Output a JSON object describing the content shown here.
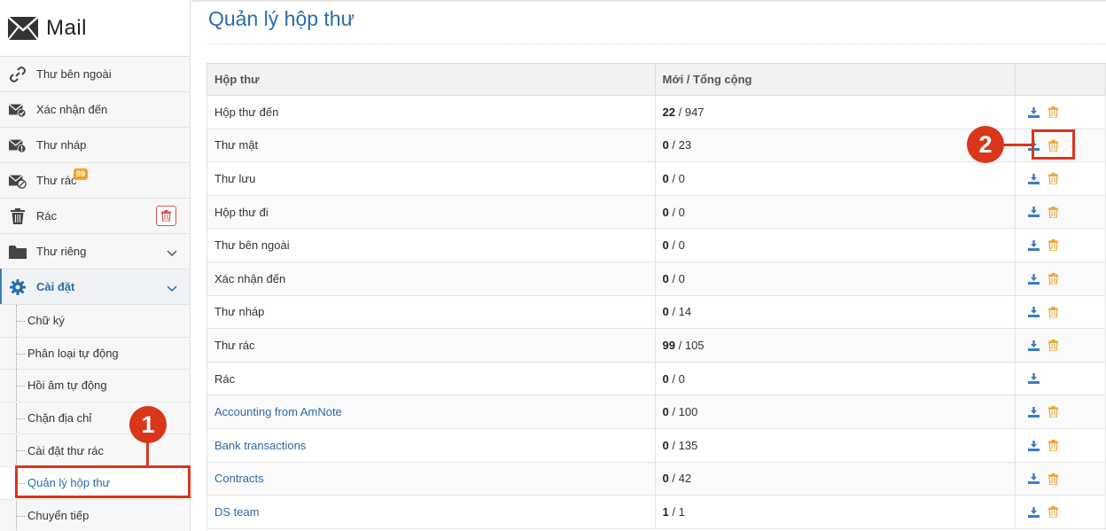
{
  "sidebar": {
    "app_title": "Mail",
    "items": [
      {
        "label": "Thư bên ngoài",
        "icon": "link-icon"
      },
      {
        "label": "Xác nhận đến",
        "icon": "envelope-check-icon"
      },
      {
        "label": "Thư nháp",
        "icon": "envelope-draft-icon"
      },
      {
        "label": "Thư rác",
        "icon": "envelope-spam-icon",
        "badge": "99"
      },
      {
        "label": "Rác",
        "icon": "trash-icon"
      },
      {
        "label": "Thư riêng",
        "icon": "folder-icon"
      },
      {
        "label": "Cài đặt",
        "icon": "gear-icon"
      }
    ],
    "settings_items": [
      {
        "label": "Chữ ký"
      },
      {
        "label": "Phân loại tự động"
      },
      {
        "label": "Hồi âm tự động"
      },
      {
        "label": "Chặn địa chỉ"
      },
      {
        "label": "Cài đặt thư rác"
      },
      {
        "label": "Quản lý hộp thư"
      },
      {
        "label": "Chuyển tiếp"
      }
    ]
  },
  "main": {
    "title": "Quản lý hộp thư",
    "columns": [
      "Hộp thư",
      "Mới / Tổng cộng",
      ""
    ],
    "rows": [
      {
        "name": "Hộp thư đến",
        "new": "22",
        "total": "947"
      },
      {
        "name": "Thư mật",
        "new": "0",
        "total": "23"
      },
      {
        "name": "Thư lưu",
        "new": "0",
        "total": "0"
      },
      {
        "name": "Hộp thư đi",
        "new": "0",
        "total": "0"
      },
      {
        "name": "Thư bên ngoài",
        "new": "0",
        "total": "0"
      },
      {
        "name": "Xác nhận đến",
        "new": "0",
        "total": "0"
      },
      {
        "name": "Thư nháp",
        "new": "0",
        "total": "14"
      },
      {
        "name": "Thư rác",
        "new": "99",
        "total": "105"
      },
      {
        "name": "Rác",
        "new": "0",
        "total": "0"
      },
      {
        "name": "Accounting from AmNote",
        "new": "0",
        "total": "100"
      },
      {
        "name": "Bank transactions",
        "new": "0",
        "total": "135"
      },
      {
        "name": "Contracts",
        "new": "0",
        "total": "42"
      },
      {
        "name": "DS team",
        "new": "1",
        "total": "1"
      }
    ]
  },
  "annotations": [
    "1",
    "2"
  ],
  "colors": {
    "accent": "#2a6ca8",
    "callout": "#d9361c",
    "delete": "#f0a232",
    "download": "#3a7cc1",
    "badge": "#f0a232"
  }
}
